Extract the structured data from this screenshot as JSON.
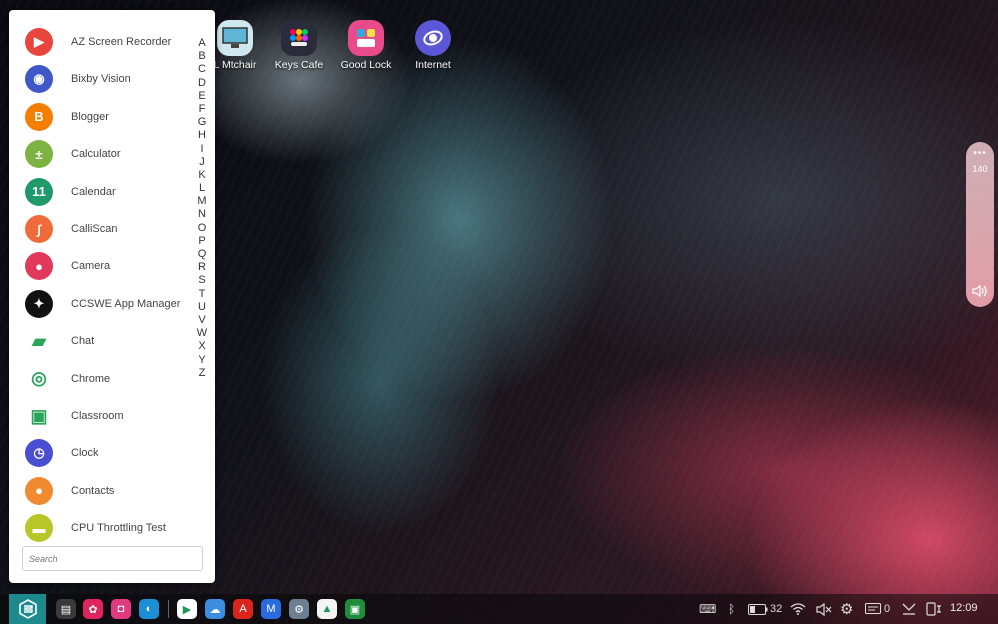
{
  "desktop": {
    "icons": [
      {
        "label": "L Mtchair",
        "name": "nitchair-desktop-icon",
        "color": "#cfe8ef"
      },
      {
        "label": "Keys Cafe",
        "name": "keys-cafe-desktop-icon",
        "color": "#2b2b3a"
      },
      {
        "label": "Good Lock",
        "name": "good-lock-desktop-icon",
        "color": "#e84a8a"
      },
      {
        "label": "Internet",
        "name": "internet-desktop-icon",
        "color": "#5b57d6"
      }
    ]
  },
  "drawer": {
    "apps": [
      {
        "label": "AZ Screen Recorder",
        "icon": "az-screen-recorder-icon",
        "color": "#e8453c",
        "glyph": "▶"
      },
      {
        "label": "Bixby Vision",
        "icon": "bixby-vision-icon",
        "color": "#3f57c9",
        "glyph": "◉"
      },
      {
        "label": "Blogger",
        "icon": "blogger-icon",
        "color": "#f57d00",
        "glyph": "B"
      },
      {
        "label": "Calculator",
        "icon": "calculator-icon",
        "color": "#7cb342",
        "glyph": "±"
      },
      {
        "label": "Calendar",
        "icon": "calendar-icon",
        "color": "#1f9a6a",
        "glyph": "11"
      },
      {
        "label": "CalliScan",
        "icon": "calliscan-icon",
        "color": "#ef6c3a",
        "glyph": "∫"
      },
      {
        "label": "Camera",
        "icon": "camera-icon",
        "color": "#e0395b",
        "glyph": "●"
      },
      {
        "label": "CCSWE App Manager",
        "icon": "ccswe-app-manager-icon",
        "color": "#111111",
        "glyph": "✦"
      },
      {
        "label": "Chat",
        "icon": "chat-icon",
        "color": "#ffffff",
        "glyph": "▰"
      },
      {
        "label": "Chrome",
        "icon": "chrome-icon",
        "color": "#ffffff",
        "glyph": "◎"
      },
      {
        "label": "Classroom",
        "icon": "classroom-icon",
        "color": "#ffffff",
        "glyph": "▣"
      },
      {
        "label": "Clock",
        "icon": "clock-icon",
        "color": "#4a4fd1",
        "glyph": "◷"
      },
      {
        "label": "Contacts",
        "icon": "contacts-icon",
        "color": "#f0892f",
        "glyph": "●"
      },
      {
        "label": "CPU Throttling Test",
        "icon": "cpu-throttling-test-icon",
        "color": "#b7c728",
        "glyph": "▬"
      }
    ],
    "alphabet": [
      "A",
      "B",
      "C",
      "D",
      "E",
      "F",
      "G",
      "H",
      "I",
      "J",
      "K",
      "L",
      "M",
      "N",
      "O",
      "P",
      "Q",
      "R",
      "S",
      "T",
      "U",
      "V",
      "W",
      "X",
      "Y",
      "Z"
    ],
    "search_placeholder": "Search"
  },
  "volume_panel": {
    "menu_glyph": "•••",
    "value": "140",
    "icon": "speaker-icon"
  },
  "taskbar": {
    "apps": [
      {
        "name": "taskbar-files-icon",
        "color": "#3a3a3a",
        "glyph": "▤"
      },
      {
        "name": "taskbar-petal-icon",
        "color": "#e0245e",
        "glyph": "✿"
      },
      {
        "name": "taskbar-galaxy-store-icon",
        "color": "#e03a7e",
        "glyph": "◘"
      },
      {
        "name": "taskbar-edge-icon",
        "color": "#1a8fd6",
        "glyph": "◐"
      },
      {
        "name": "taskbar-play-store-icon",
        "color": "#ffffff",
        "glyph": "▶"
      },
      {
        "name": "taskbar-weather-icon",
        "color": "#3d8de0",
        "glyph": "☁"
      },
      {
        "name": "taskbar-acrobat-icon",
        "color": "#d9251c",
        "glyph": "A"
      },
      {
        "name": "taskbar-m-app-icon",
        "color": "#2a6be0",
        "glyph": "M"
      },
      {
        "name": "taskbar-settings-icon",
        "color": "#6d7f92",
        "glyph": "⚙"
      },
      {
        "name": "taskbar-drive-icon",
        "color": "#f4f4f4",
        "glyph": "▲"
      },
      {
        "name": "taskbar-classroom-icon",
        "color": "#1e8e3e",
        "glyph": "▣"
      }
    ],
    "tray": {
      "keyboard": "⌨",
      "bluetooth": "ᛒ",
      "battery_level": "32",
      "wifi": "◠",
      "mute": "🔇",
      "settings": "⚙",
      "notifications_count": "0",
      "download": "⤓",
      "screen": "▯",
      "time": "12:09"
    }
  }
}
